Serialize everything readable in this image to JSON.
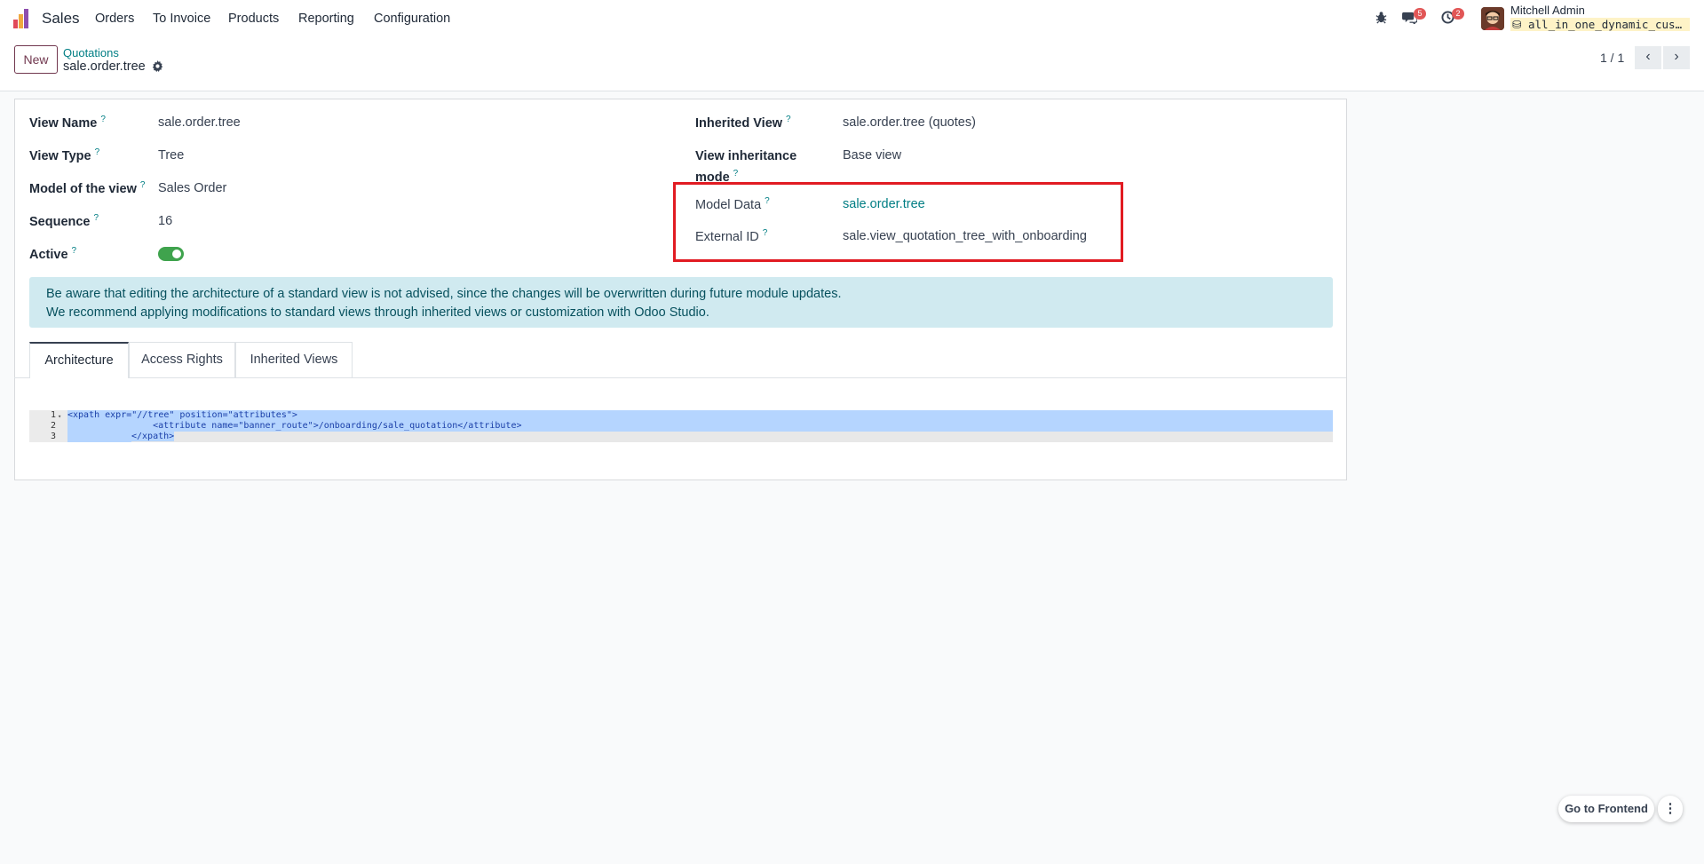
{
  "navbar": {
    "app_name": "Sales",
    "menu": [
      "Orders",
      "To Invoice",
      "Products",
      "Reporting",
      "Configuration"
    ],
    "messages_badge": "5",
    "activities_badge": "2",
    "user_name": "Mitchell Admin",
    "database": "all_in_one_dynamic_custom_fields"
  },
  "control_panel": {
    "new_button": "New",
    "breadcrumb_parent": "Quotations",
    "breadcrumb_current": "sale.order.tree",
    "pager": "1 / 1"
  },
  "form": {
    "left": [
      {
        "label": "View Name",
        "value": "sale.order.tree"
      },
      {
        "label": "View Type",
        "value": "Tree"
      },
      {
        "label": "Model of the view",
        "value": "Sales Order"
      },
      {
        "label": "Sequence",
        "value": "16"
      },
      {
        "label": "Active",
        "value": true
      }
    ],
    "right": [
      {
        "label": "Inherited View",
        "value": "sale.order.tree (quotes)"
      },
      {
        "label": "View inheritance mode",
        "value": "Base view"
      },
      {
        "label": "Model Data",
        "value": "sale.order.tree"
      },
      {
        "label": "External ID",
        "value": "sale.view_quotation_tree_with_onboarding"
      }
    ],
    "tooltip_mark": "?"
  },
  "alert": {
    "line1": "Be aware that editing the architecture of a standard view is not advised, since the changes will be overwritten during future module updates.",
    "line2": "We recommend applying modifications to standard views through inherited views or customization with Odoo Studio."
  },
  "tabs": [
    "Architecture",
    "Access Rights",
    "Inherited Views"
  ],
  "architecture": {
    "lines": [
      "<xpath expr=\"//tree\" position=\"attributes\">",
      "    <attribute name=\"banner_route\">/onboarding/sale_quotation</attribute>",
      "</xpath>"
    ]
  },
  "footer": {
    "go_to_frontend": "Go to Frontend"
  },
  "colors": {
    "brand": "#71384f",
    "link": "#017e84",
    "highlight_box": "#e11b22",
    "alert_bg": "#d0eaf0",
    "toggle_on": "#3fa34d"
  }
}
